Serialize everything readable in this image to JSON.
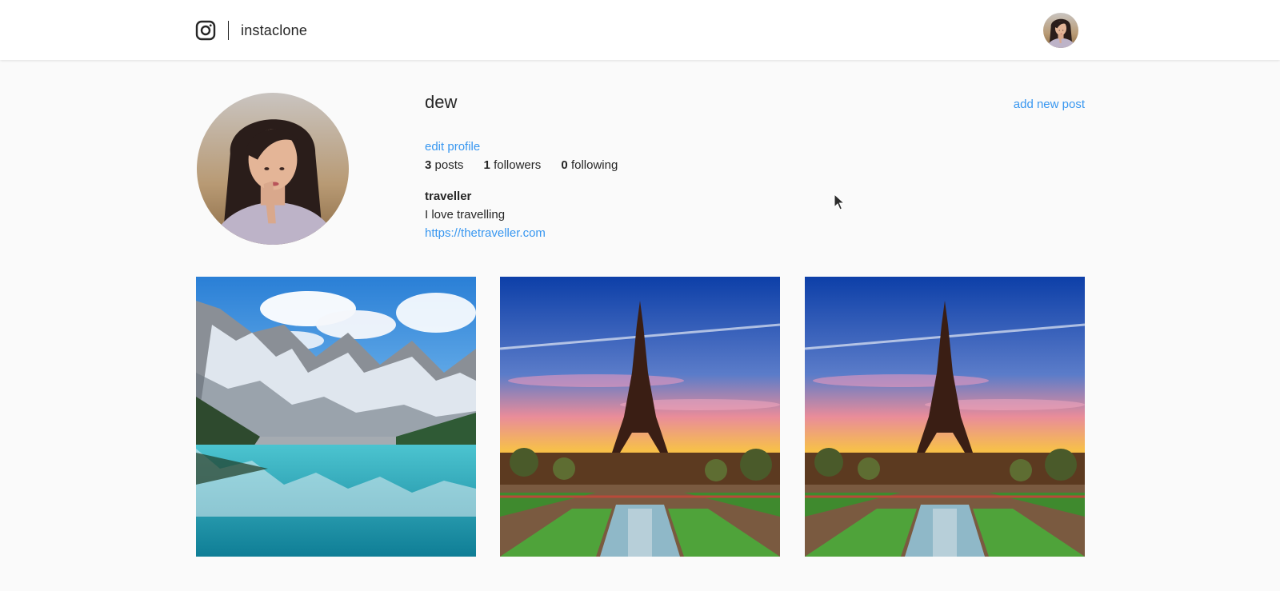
{
  "header": {
    "logo_icon": "instagram-logo-icon",
    "app_name": "instaclone",
    "user_avatar": "avatar-photo"
  },
  "profile": {
    "username": "dew",
    "edit_profile_label": "edit profile",
    "add_post_label": "add new post",
    "stats": {
      "posts_count": "3",
      "posts_label": "posts",
      "followers_count": "1",
      "followers_label": "followers",
      "following_count": "0",
      "following_label": "following"
    },
    "bio": {
      "name": "traveller",
      "text": "I love travelling",
      "link": "https://thetraveller.com"
    }
  },
  "posts": [
    {
      "image": "mountain-lake-photo"
    },
    {
      "image": "eiffel-tower-sunset-photo"
    },
    {
      "image": "eiffel-tower-sunset-photo"
    }
  ],
  "colors": {
    "accent_link": "#3897f0",
    "text": "#262626",
    "background": "#fafafa",
    "header_bg": "#ffffff"
  }
}
